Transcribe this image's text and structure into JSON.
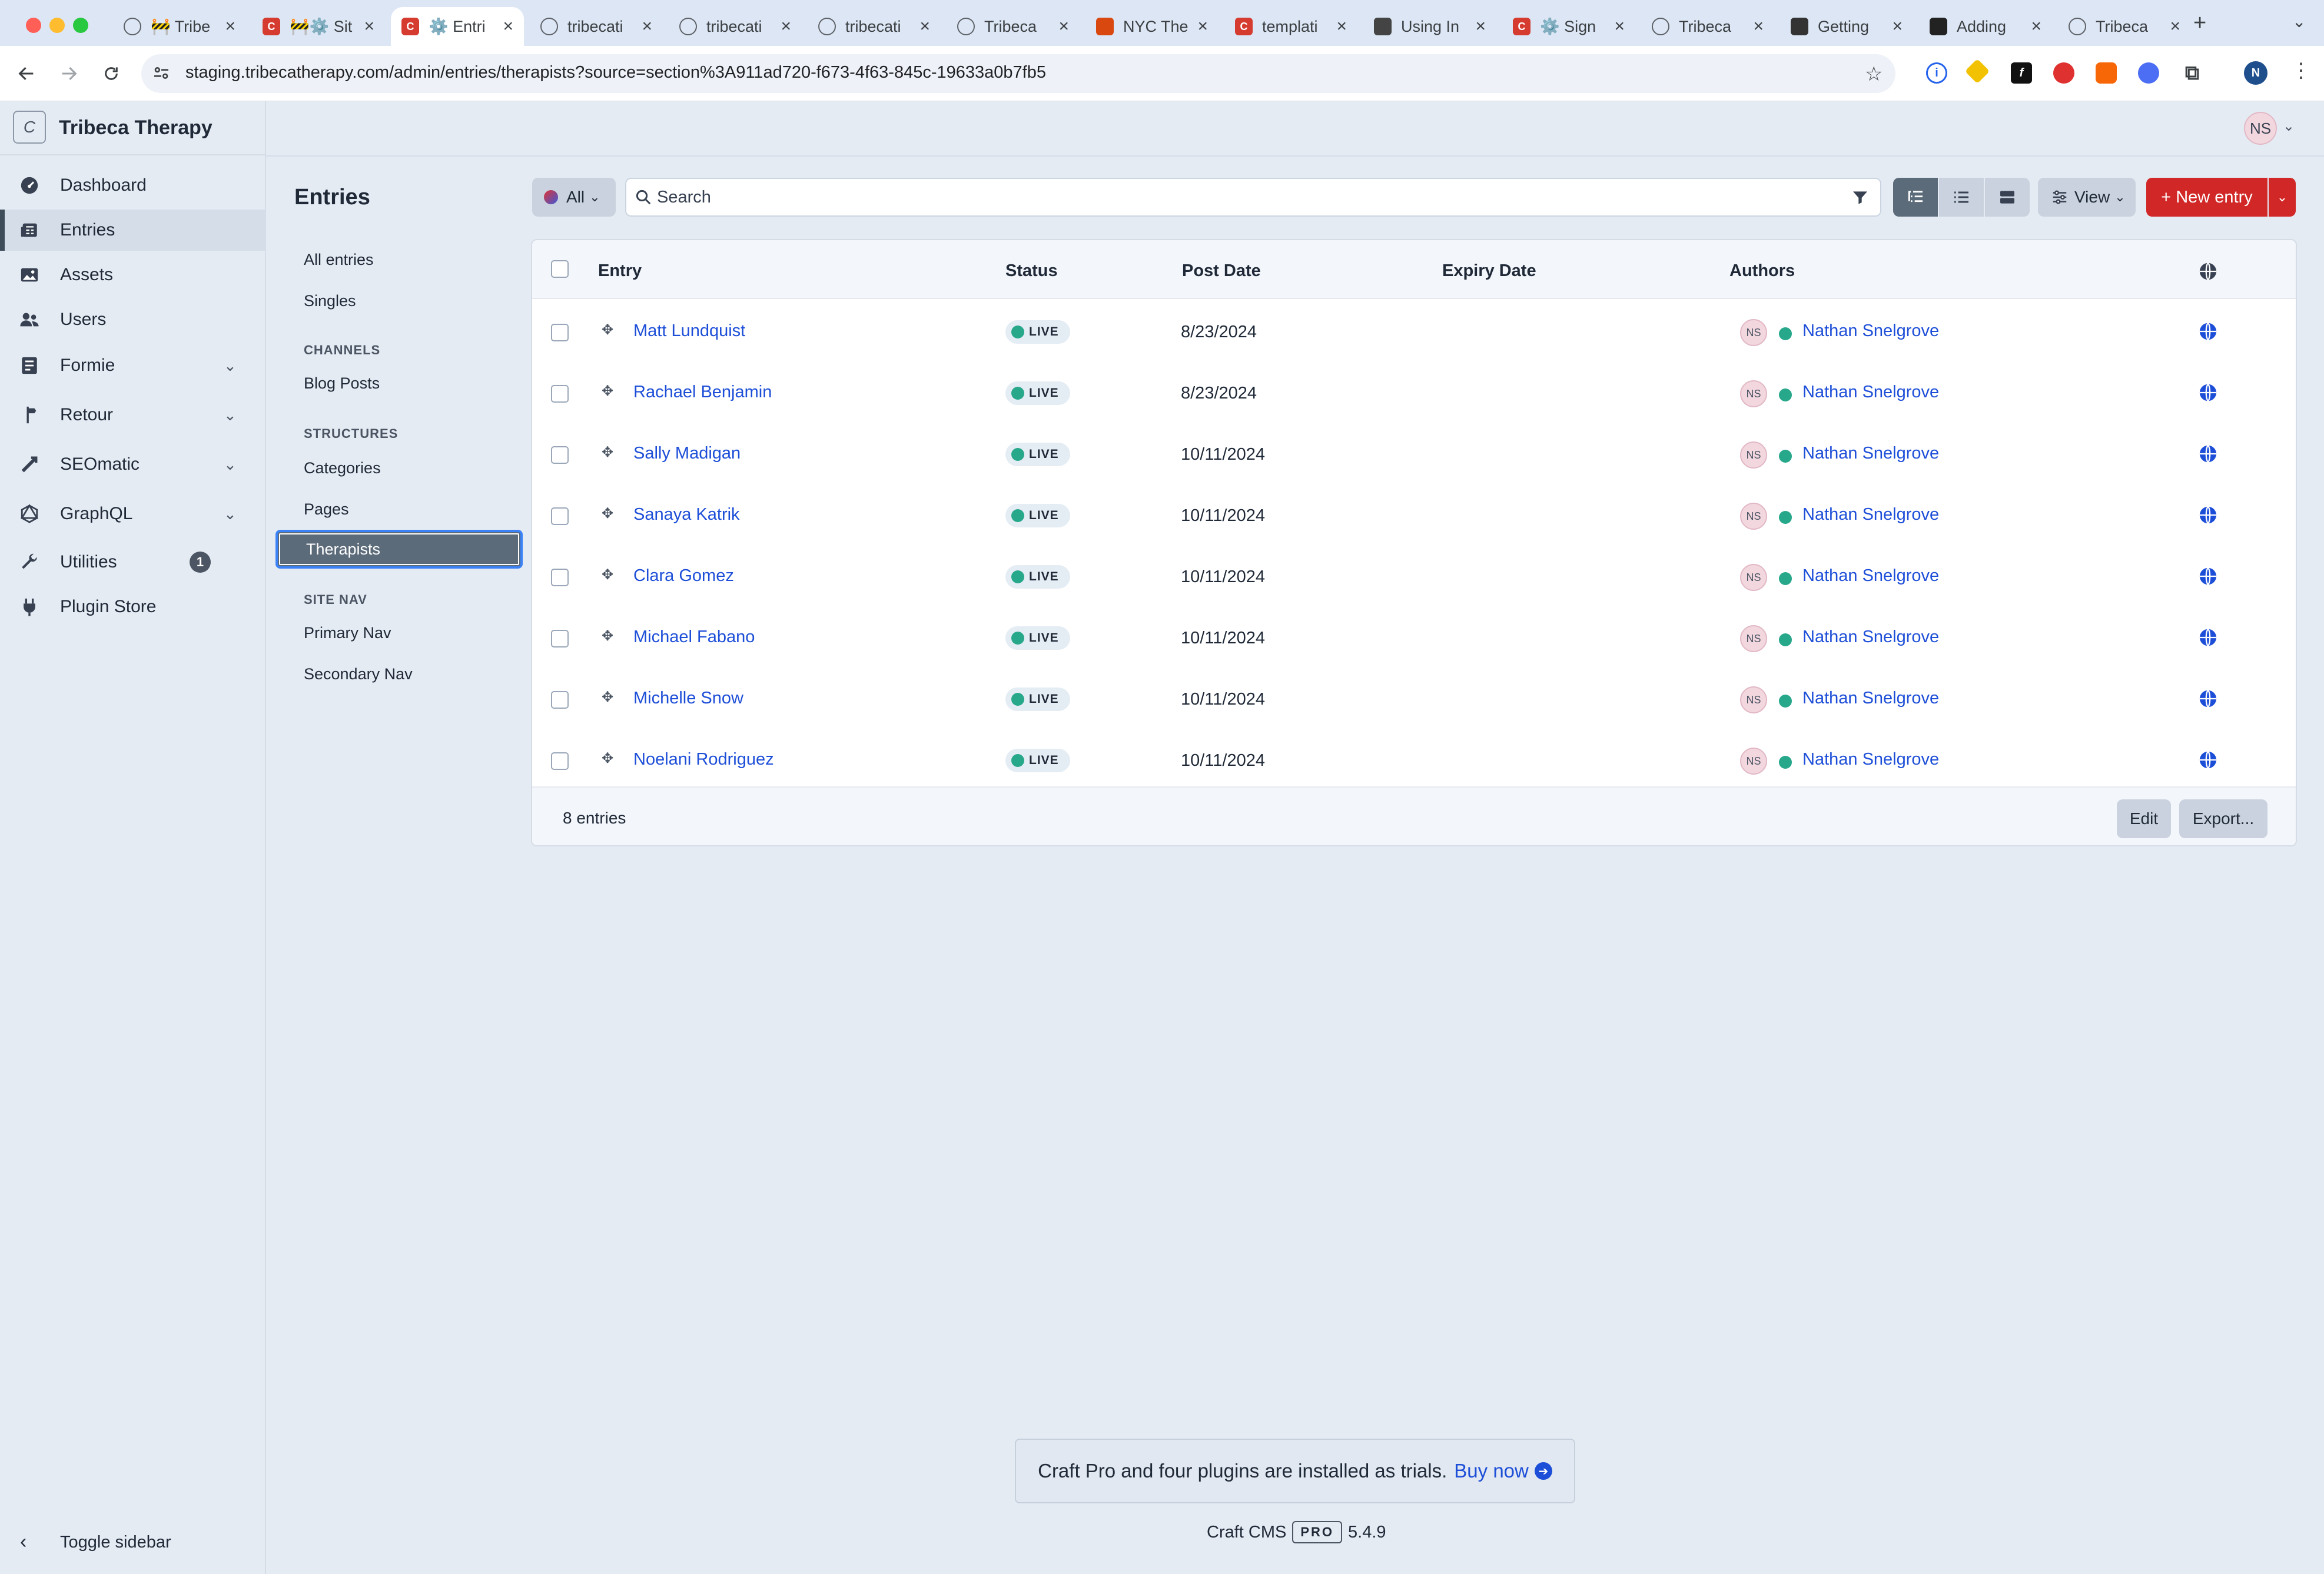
{
  "browser": {
    "tabs": [
      {
        "title": "🚧 Tribe",
        "fav": "globe",
        "color": "#5f6368"
      },
      {
        "title": "🚧⚙️ Sit",
        "fav": "C",
        "color": "#d63b2f"
      },
      {
        "title": "⚙️ Entri",
        "fav": "C",
        "color": "#d63b2f",
        "active": true
      },
      {
        "title": "tribecati",
        "fav": "globe",
        "color": "#5f6368"
      },
      {
        "title": "tribecati",
        "fav": "globe",
        "color": "#5f6368"
      },
      {
        "title": "tribecati",
        "fav": "globe",
        "color": "#5f6368"
      },
      {
        "title": "Tribeca",
        "fav": "globe",
        "color": "#5f6368"
      },
      {
        "title": "NYC The",
        "fav": "grid",
        "color": "#d9480f"
      },
      {
        "title": "templati",
        "fav": "C",
        "color": "#d63b2f"
      },
      {
        "title": "Using In",
        "fav": "dot",
        "color": "#444"
      },
      {
        "title": "⚙️ Sign",
        "fav": "C",
        "color": "#d63b2f"
      },
      {
        "title": "Tribeca",
        "fav": "globe",
        "color": "#5f6368"
      },
      {
        "title": "Getting",
        "fav": "book",
        "color": "#333"
      },
      {
        "title": "Adding",
        "fav": "gh",
        "color": "#222"
      },
      {
        "title": "Tribeca",
        "fav": "globe",
        "color": "#5f6368"
      }
    ],
    "url": "staging.tribecatherapy.com/admin/entries/therapists?source=section%3A911ad720-f673-4f63-845c-19633a0b7fb5",
    "profile_initial": "N"
  },
  "app": {
    "logo_letter": "C",
    "site_name": "Tribeca Therapy",
    "user_initials": "NS"
  },
  "nav": {
    "items": [
      {
        "label": "Dashboard",
        "icon": "gauge-icon"
      },
      {
        "label": "Entries",
        "icon": "newspaper-icon",
        "selected": true
      },
      {
        "label": "Assets",
        "icon": "image-icon"
      },
      {
        "label": "Users",
        "icon": "users-icon"
      },
      {
        "label": "Formie",
        "icon": "form-icon",
        "expandable": true
      },
      {
        "label": "Retour",
        "icon": "signpost-icon",
        "expandable": true
      },
      {
        "label": "SEOmatic",
        "icon": "seo-icon",
        "expandable": true
      },
      {
        "label": "GraphQL",
        "icon": "graphql-icon",
        "expandable": true
      },
      {
        "label": "Utilities",
        "icon": "wrench-icon",
        "badge": "1"
      },
      {
        "label": "Plugin Store",
        "icon": "plug-icon"
      }
    ],
    "toggle_label": "Toggle sidebar"
  },
  "entries": {
    "page_title": "Entries",
    "sources": {
      "all_entries": "All entries",
      "singles": "Singles",
      "channels_heading": "CHANNELS",
      "blog_posts": "Blog Posts",
      "structures_heading": "STRUCTURES",
      "categories": "Categories",
      "pages": "Pages",
      "therapists": "Therapists",
      "site_nav_heading": "SITE NAV",
      "primary_nav": "Primary Nav",
      "secondary_nav": "Secondary Nav"
    },
    "toolbar": {
      "site_label": "All",
      "search_placeholder": "Search",
      "view_label": "View",
      "new_entry_label": "+ New entry"
    },
    "table": {
      "columns": {
        "entry": "Entry",
        "status": "Status",
        "post_date": "Post Date",
        "expiry_date": "Expiry Date",
        "authors": "Authors"
      },
      "rows": [
        {
          "title": "Matt Lundquist",
          "status": "LIVE",
          "post_date": "8/23/2024",
          "author_initials": "NS",
          "author": "Nathan Snelgrove"
        },
        {
          "title": "Rachael Benjamin",
          "status": "LIVE",
          "post_date": "8/23/2024",
          "author_initials": "NS",
          "author": "Nathan Snelgrove"
        },
        {
          "title": "Sally Madigan",
          "status": "LIVE",
          "post_date": "10/11/2024",
          "author_initials": "NS",
          "author": "Nathan Snelgrove"
        },
        {
          "title": "Sanaya Katrik",
          "status": "LIVE",
          "post_date": "10/11/2024",
          "author_initials": "NS",
          "author": "Nathan Snelgrove"
        },
        {
          "title": "Clara Gomez",
          "status": "LIVE",
          "post_date": "10/11/2024",
          "author_initials": "NS",
          "author": "Nathan Snelgrove"
        },
        {
          "title": "Michael Fabano",
          "status": "LIVE",
          "post_date": "10/11/2024",
          "author_initials": "NS",
          "author": "Nathan Snelgrove"
        },
        {
          "title": "Michelle Snow",
          "status": "LIVE",
          "post_date": "10/11/2024",
          "author_initials": "NS",
          "author": "Nathan Snelgrove"
        },
        {
          "title": "Noelani Rodriguez",
          "status": "LIVE",
          "post_date": "10/11/2024",
          "author_initials": "NS",
          "author": "Nathan Snelgrove"
        }
      ],
      "count_label": "8 entries",
      "edit_label": "Edit",
      "export_label": "Export..."
    }
  },
  "footer": {
    "trial_text": "Craft Pro and four plugins are installed as trials.",
    "buy_label": "Buy now",
    "cms_name": "Craft CMS",
    "edition": "PRO",
    "version": "5.4.9"
  },
  "colors": {
    "accent_red": "#d12727",
    "link_blue": "#1d4ed8",
    "live_green": "#27a88b",
    "selected_source": "#5c6b7a"
  }
}
